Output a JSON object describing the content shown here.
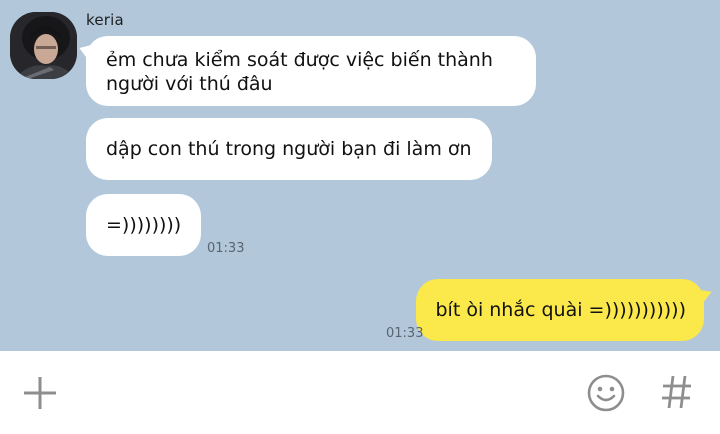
{
  "chat": {
    "sender_name": "keria",
    "messages": [
      {
        "text": "ẻm chưa kiểm soát được việc biến thành người với thú đâu"
      },
      {
        "text": "dập con thú trong người bạn đi làm ơn"
      },
      {
        "text": "=))))))))"
      }
    ],
    "received_time": "01:33",
    "my_message": {
      "text": "bít òi nhắc quài =)))))))))))",
      "time": "01:33"
    }
  },
  "input_bar": {
    "left_icon": "plus-icon",
    "right_icons": [
      "emoji-icon",
      "hashtag-icon"
    ]
  },
  "colors": {
    "chat_background": "#b2c7da",
    "incoming_bubble": "#ffffff",
    "outgoing_bubble": "#fbe84a",
    "icon_gray": "#8e8e8e"
  }
}
